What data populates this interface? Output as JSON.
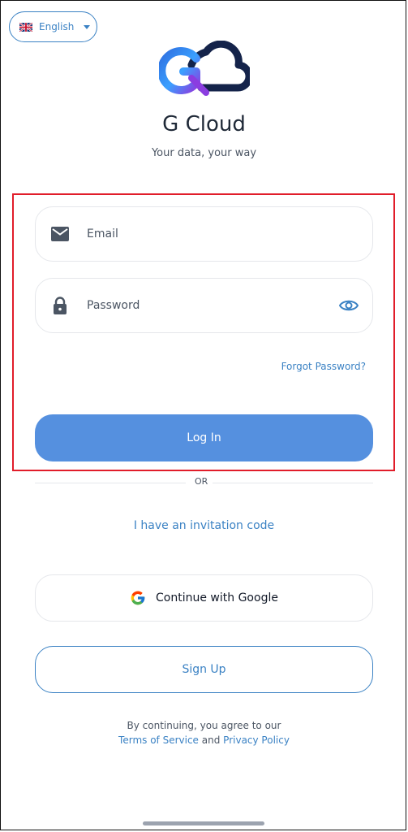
{
  "language": {
    "label": "English",
    "flag_icon": "uk-flag-icon"
  },
  "brand": {
    "title": "G Cloud",
    "subtitle": "Your data, your way",
    "logo_icon": "g-cloud-logo-icon"
  },
  "login_form": {
    "email_placeholder": "Email",
    "password_placeholder": "Password",
    "forgot_password": "Forgot Password?",
    "login_button": "Log In"
  },
  "divider": {
    "text": "OR"
  },
  "invitation": {
    "link": "I have an invitation code"
  },
  "google": {
    "label": "Continue with Google"
  },
  "signup": {
    "label": "Sign Up"
  },
  "legal": {
    "prefix": "By continuing, you agree to our",
    "terms": "Terms of Service",
    "and": "and",
    "privacy": "Privacy Policy"
  },
  "colors": {
    "primary": "#5590df",
    "link": "#3b82c4",
    "highlight_border": "#e11d2a"
  }
}
